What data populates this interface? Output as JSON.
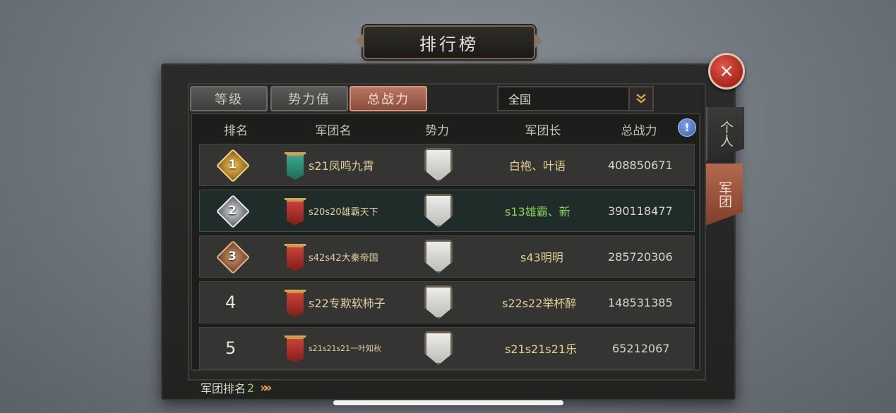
{
  "title": "排行榜",
  "tabs": [
    {
      "label": "等级",
      "active": false
    },
    {
      "label": "势力值",
      "active": false
    },
    {
      "label": "总战力",
      "active": true
    }
  ],
  "region": {
    "selected": "全国"
  },
  "headers": {
    "rank": "排名",
    "legion": "军团名",
    "faction": "势力",
    "leader": "军团长",
    "power": "总战力"
  },
  "info_icon": "!",
  "close_icon": "×",
  "rows": [
    {
      "rank": "1",
      "legion": "s21凤鸣九霄",
      "leader": "白袍、叶语",
      "power": "408850671",
      "banner_color": "#2f8f7a",
      "medal_color": "#c9962f"
    },
    {
      "rank": "2",
      "legion": "s20s20雄霸天下",
      "leader": "s13雄霸、新",
      "power": "390118477",
      "banner_color": "#b3332b",
      "medal_color": "#9a9da2"
    },
    {
      "rank": "3",
      "legion": "s42s42大秦帝国",
      "leader": "s43明明",
      "power": "285720306",
      "banner_color": "#b3332b",
      "medal_color": "#a36a45"
    },
    {
      "rank": "4",
      "legion": "s22专欺软柿子",
      "leader": "s22s22举杯醉",
      "power": "148531385",
      "banner_color": "#b3332b"
    },
    {
      "rank": "5",
      "legion": "s21s21s21一叶知秋",
      "leader": "s21s21s21乐",
      "power": "65212067",
      "banner_color": "#b3332b"
    }
  ],
  "side_tabs": [
    {
      "label": "个人",
      "active": false
    },
    {
      "label": "军团",
      "active": true
    }
  ],
  "footer": {
    "label": "军团排名",
    "value": "2"
  }
}
